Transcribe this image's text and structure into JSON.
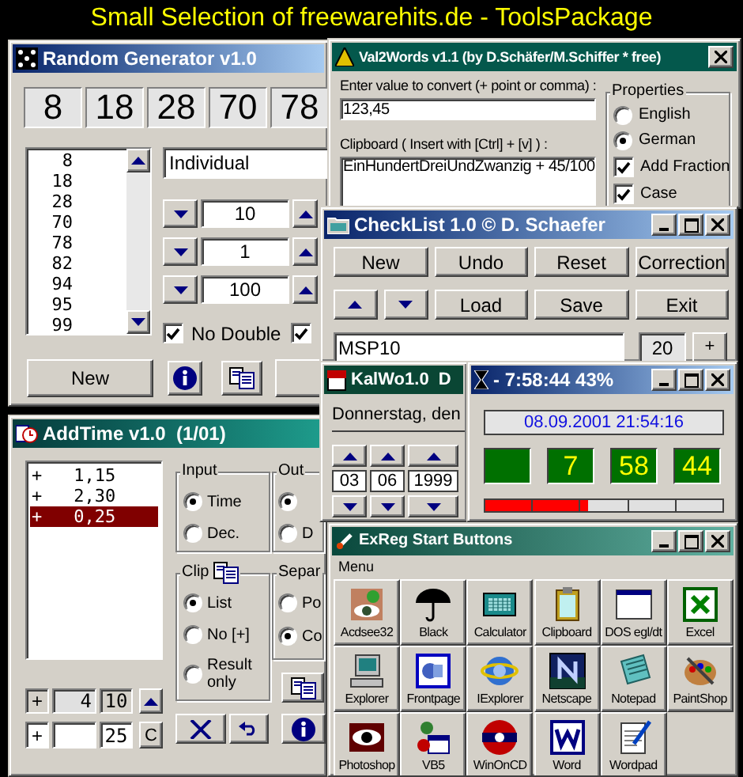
{
  "banner": {
    "title": "Small Selection of freewarehits.de - ToolsPackage"
  },
  "random_generator": {
    "title": "Random Generator v1.0",
    "numbers": [
      "8",
      "18",
      "28",
      "70",
      "78"
    ],
    "list": [
      "8",
      "18",
      "28",
      "70",
      "78",
      "82",
      "94",
      "95",
      "99"
    ],
    "mode": "Individual",
    "spinners": [
      "10",
      "1",
      "100"
    ],
    "checkboxes": [
      {
        "label": "No Double",
        "checked": true
      },
      {
        "checked": true
      }
    ],
    "button": "New"
  },
  "addtime": {
    "title": "AddTime v1.0  (1/01)",
    "entries": [
      {
        "sign": "+",
        "value": "1,15",
        "selected": false
      },
      {
        "sign": "+",
        "value": "2,30",
        "selected": false
      },
      {
        "sign": "+",
        "value": "0,25",
        "selected": true
      }
    ],
    "input_group": {
      "title": "Input",
      "options": [
        {
          "label": "Time",
          "selected": true
        },
        {
          "label": "Dec.",
          "selected": false
        }
      ]
    },
    "output_group": {
      "title": "Out",
      "options": [
        {
          "selected": true
        },
        {
          "label": "D",
          "selected": false
        }
      ]
    },
    "clip_group": {
      "title": "Clip",
      "options": [
        {
          "label": "List",
          "selected": true
        },
        {
          "label": "No [+]",
          "selected": false
        },
        {
          "label": "Result only",
          "selected": false
        }
      ]
    },
    "separator_group": {
      "title": "Separ",
      "options": [
        {
          "label": "Po",
          "selected": false
        },
        {
          "label": "Co",
          "selected": true
        }
      ]
    },
    "total": {
      "sign": "+",
      "hours": "4",
      "minutes": "10"
    },
    "new_entry": {
      "sign": "+",
      "minutes": "25",
      "clear": "C"
    }
  },
  "val2words": {
    "title": "Val2Words v1.1 (by D.Schäfer/M.Schiffer * free)",
    "input_label": "Enter value to convert (+ point or comma) :",
    "input": "123,45",
    "clipboard_label": "Clipboard  ( Insert with [Ctrl] + [v] ) :",
    "clipboard": "EinHundertDreiUndZwanzig + 45/100",
    "properties": {
      "title": "Properties",
      "options": [
        {
          "kind": "radio",
          "label": "English",
          "selected": false
        },
        {
          "kind": "radio",
          "label": "German",
          "selected": true
        },
        {
          "kind": "checkbox",
          "label": "Add Fraction",
          "checked": true
        },
        {
          "kind": "checkbox",
          "label": "Case",
          "checked": true
        }
      ]
    }
  },
  "checklist": {
    "title": "CheckList 1.0 © D. Schaefer",
    "buttons": [
      "New",
      "Undo",
      "Reset",
      "Correction"
    ],
    "buttons_row2": [
      "Load",
      "Save",
      "Exit"
    ],
    "entry": "MSP10",
    "count": "20",
    "plus": "+"
  },
  "kalwo": {
    "title": "KalWo1.0  D",
    "date_text": "Donnerstag, den",
    "date": [
      "03",
      "06",
      "1999"
    ]
  },
  "clock": {
    "title": "- 7:58:44 43%",
    "datetime": "08.09.2001 21:54:16",
    "digits": [
      "7",
      "58",
      "44"
    ],
    "level": 0.43
  },
  "exreg": {
    "title": "ExReg Start Buttons",
    "menu": "Menu",
    "apps": [
      "Acdsee32",
      "Black",
      "Calculator",
      "Clipboard",
      "DOS egl/dt",
      "Excel",
      "Explorer",
      "Frontpage",
      "IExplorer",
      "Netscape",
      "Notepad",
      "PaintShop",
      "Photoshop",
      "VB5",
      "WinOnCD",
      "Word",
      "Wordpad"
    ]
  }
}
